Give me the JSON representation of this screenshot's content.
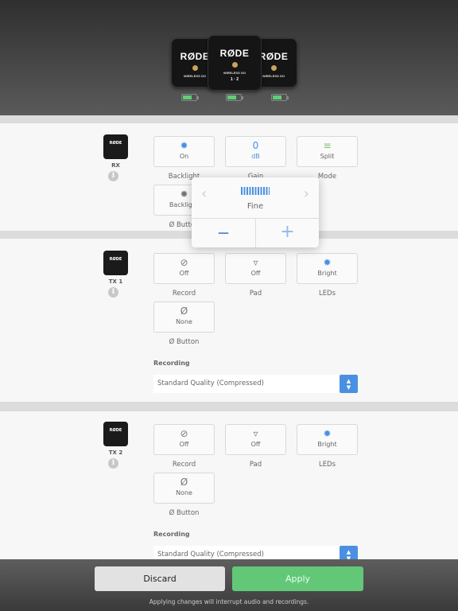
{
  "hero": {
    "devices": [
      {
        "logo": "RØDE",
        "badge": "WIRELESS GO"
      },
      {
        "logo": "RØDE",
        "badge": "WIRELESS GO",
        "channels": [
          "1",
          "2"
        ]
      },
      {
        "logo": "RØDE",
        "badge": "WIRELESS GO"
      }
    ],
    "battery_levels": [
      0.7,
      0.7,
      0.7
    ]
  },
  "sections": [
    {
      "name": "RX",
      "tiles": [
        {
          "icon": "sun-icon",
          "value": "On",
          "label": "Backlight",
          "accent": true
        },
        {
          "icon": "gain",
          "value": "0",
          "unit": "dB",
          "label": "Gain",
          "accent": true
        },
        {
          "icon": "split-bars-icon",
          "value": "Split",
          "label": "Mode"
        },
        {
          "icon": "sun-dim-icon",
          "value": "Backlight",
          "label": "Ø Button"
        }
      ]
    },
    {
      "name": "TX 1",
      "tiles": [
        {
          "icon": "record-off-icon",
          "value": "Off",
          "label": "Record"
        },
        {
          "icon": "pad-icon",
          "value": "Off",
          "label": "Pad"
        },
        {
          "icon": "sun-icon",
          "value": "Bright",
          "label": "LEDs",
          "accent": true
        },
        {
          "icon": "phase-icon",
          "value": "None",
          "label": "Ø Button"
        }
      ],
      "recording_label": "Recording",
      "recording_value": "Standard Quality (Compressed)"
    },
    {
      "name": "TX 2",
      "tiles": [
        {
          "icon": "record-off-icon",
          "value": "Off",
          "label": "Record"
        },
        {
          "icon": "pad-icon",
          "value": "Off",
          "label": "Pad"
        },
        {
          "icon": "sun-icon",
          "value": "Bright",
          "label": "LEDs",
          "accent": true
        },
        {
          "icon": "phase-icon",
          "value": "None",
          "label": "Ø Button"
        }
      ],
      "recording_label": "Recording",
      "recording_value": "Standard Quality (Compressed)"
    }
  ],
  "popover": {
    "mode": "Fine",
    "prev": "‹",
    "next": "›",
    "minus": "—",
    "plus": "+"
  },
  "footer": {
    "discard": "Discard",
    "apply": "Apply",
    "note": "Applying changes will interrupt audio and recordings."
  },
  "colors": {
    "accent": "#4a90e2",
    "apply": "#62c878"
  }
}
